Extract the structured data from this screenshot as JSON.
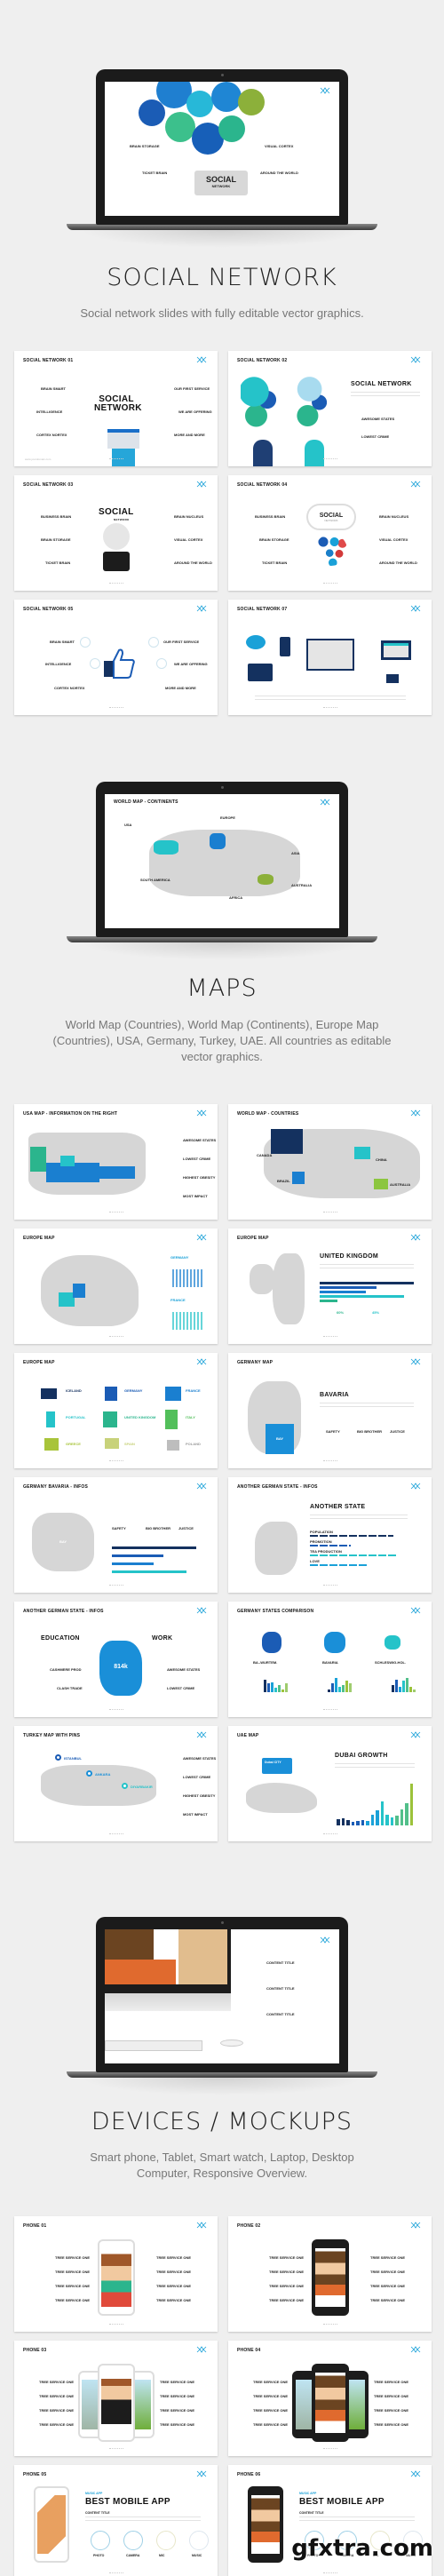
{
  "sections": {
    "social": {
      "title": "SOCIAL NETWORK",
      "subtitle": "Social network slides with fully editable vector graphics.",
      "hero": {
        "labels": [
          "BRAIN STORAGE",
          "VISUAL CORTEX",
          "TICKET BRAIN",
          "AROUND THE WORLD"
        ],
        "center_title": "SOCIAL",
        "center_sub": "NETWORK"
      },
      "slides": [
        {
          "title": "SOCIAL NETWORK 01",
          "center": "SOCIAL NETWORK",
          "labels": [
            "BRAIN SMART",
            "INTELLIGENCE",
            "CORTEX NORTEX",
            "OUR FIRST SERVICE",
            "WE ARE OFFERING",
            "MORE AND MORE"
          ]
        },
        {
          "title": "SOCIAL NETWORK 02",
          "heading": "SOCIAL NETWORK",
          "labels": [
            "AWESOME STATES",
            "LOWEST CRIME"
          ]
        },
        {
          "title": "SOCIAL NETWORK 03",
          "center": "SOCIAL",
          "center_sub": "NETWORK",
          "labels": [
            "BUSINESS BRAIN",
            "BRAIN STORAGE",
            "TICKET BRAIN",
            "BRAIN NUCLEUS",
            "VISUAL CORTEX",
            "AROUND THE WORLD"
          ]
        },
        {
          "title": "SOCIAL NETWORK 04",
          "center": "SOCIAL",
          "center_sub": "NETWORK",
          "labels": [
            "BUSINESS BRAIN",
            "BRAIN STORAGE",
            "TICKET BRAIN",
            "BRAIN NUCLEUS",
            "VISUAL CORTEX",
            "AROUND THE WORLD"
          ]
        },
        {
          "title": "SOCIAL NETWORK 05",
          "labels": [
            "BRAIN SMART",
            "INTELLIGENCE",
            "CORTEX NORTEX",
            "OUR FIRST SERVICE",
            "WE ARE OFFERING",
            "MORE AND MORE"
          ]
        },
        {
          "title": "SOCIAL NETWORK 07"
        }
      ]
    },
    "maps": {
      "title": "MAPS",
      "subtitle": "World Map (Countries), World Map (Continents), Europe Map (Countries), USA, Germany, Turkey, UAE. All countries as editable vector graphics.",
      "hero": {
        "title": "WORLD MAP - CONTINENTS",
        "labels": [
          "USA",
          "EUROPE",
          "ASIA",
          "SOUTH AMERICA",
          "AFRICA",
          "AUSTRALIA"
        ]
      },
      "slides": [
        {
          "title": "USA MAP - INFORMATION ON THE RIGHT",
          "labels": [
            "AWESOME STATES",
            "LOWEST CRIME",
            "HIGHEST OBESITY",
            "MOST IMPACT"
          ]
        },
        {
          "title": "WORLD MAP - COUNTRIES",
          "labels": [
            "CANADA",
            "BRAZIL",
            "CHINA",
            "AUSTRALIA"
          ]
        },
        {
          "title": "EUROPE MAP",
          "labels": [
            "GERMANY",
            "FRANCE"
          ]
        },
        {
          "title": "EUROPE MAP",
          "heading": "UNITED KINGDOM",
          "stats": [
            "60%",
            "45%"
          ]
        },
        {
          "title": "EUROPE MAP",
          "labels": [
            "ICELAND",
            "GERMANY",
            "FRANCE",
            "PORTUGAL",
            "UNITED KINGDOM",
            "ITALY",
            "GREECE",
            "SPAIN",
            "POLAND"
          ]
        },
        {
          "title": "GERMANY MAP",
          "heading": "BAVARIA",
          "map_label": "BAY",
          "labels": [
            "SAFETY",
            "BIG BROTHER",
            "JUSTICE"
          ]
        },
        {
          "title": "GERMANY BAVARIA - INFOS",
          "map_label": "BAY",
          "labels": [
            "SAFETY",
            "BIG BROTHER",
            "JUSTICE"
          ],
          "bars": [
            0.95,
            0.58,
            0.47,
            0.84
          ]
        },
        {
          "title": "ANOTHER GERMAN STATE - INFOS",
          "heading": "ANOTHER STATE",
          "labels": [
            "POPULATION",
            "PROMOTION",
            "TEA PRODUCTION",
            "LOVE"
          ],
          "bars": [
            0.85,
            0.42,
            0.9,
            0.58
          ]
        },
        {
          "title": "ANOTHER GERMAN STATE - INFOS",
          "heading_left": "EDUCATION",
          "heading_right": "WORK",
          "map_label": "814k",
          "labels": [
            "CASHMERE PROD",
            "CLASH TRADE",
            "AWESOME STATES",
            "LOWEST CRIME"
          ]
        },
        {
          "title": "GERMANY STATES COMPARISON",
          "labels": [
            "BA.-WURTEM.",
            "BAVARIA",
            "SCHLESWIG-HOL."
          ]
        },
        {
          "title": "TURKEY MAP WITH PINS",
          "labels": [
            "ISTANBUL",
            "ANKARA",
            "DIYARBAKIR",
            "AWESOME STATES",
            "LOWEST CRIME",
            "HIGHEST OBESITY",
            "MOST IMPACT"
          ]
        },
        {
          "title": "UAE MAP",
          "heading": "DUBAI GROWTH",
          "callout": "Dubai CITY",
          "bars": [
            0.12,
            0.14,
            0.1,
            0.06,
            0.08,
            0.1,
            0.08,
            0.2,
            0.28,
            0.45,
            0.2,
            0.15,
            0.18,
            0.3,
            0.42,
            0.78
          ]
        }
      ]
    },
    "devices": {
      "title": "DEVICES / MOCKUPS",
      "subtitle": "Smart phone, Tablet, Smart watch, Laptop, Desktop Computer, Responsive Overview.",
      "hero": {
        "labels": [
          "CONTENT TITLE",
          "CONTENT TITLE",
          "CONTENT TITLE"
        ]
      },
      "slides": [
        {
          "title": "PHONE 01",
          "item": "TREE SERVICE ONE"
        },
        {
          "title": "PHONE 02",
          "item": "TREE SERVICE ONE"
        },
        {
          "title": "PHONE 03",
          "item": "TREE SERVICE ONE"
        },
        {
          "title": "PHONE 04",
          "item": "TREE SERVICE ONE"
        },
        {
          "title": "PHONE 05",
          "kicker": "MUSIC APP",
          "heading": "BEST MOBILE APP",
          "content": "CONTENT TITLE",
          "features": [
            "PHOTO",
            "CAMERA",
            "MIC",
            "MUSIC"
          ]
        },
        {
          "title": "PHONE 06",
          "kicker": "MUSIC APP",
          "heading": "BEST MOBILE APP",
          "content": "CONTENT TITLE",
          "features": [
            "PHOTO",
            "CAMERA",
            "MIC",
            "MUSIC"
          ]
        }
      ]
    }
  },
  "watermark": {
    "brand": "gfxtra.com"
  },
  "colors": {
    "accent": "#1aa1d8",
    "navy": "#14315f",
    "teal": "#25c3c9",
    "green": "#52bf8a",
    "lime": "#9cc23a",
    "gray_map": "#d6d6d6"
  }
}
